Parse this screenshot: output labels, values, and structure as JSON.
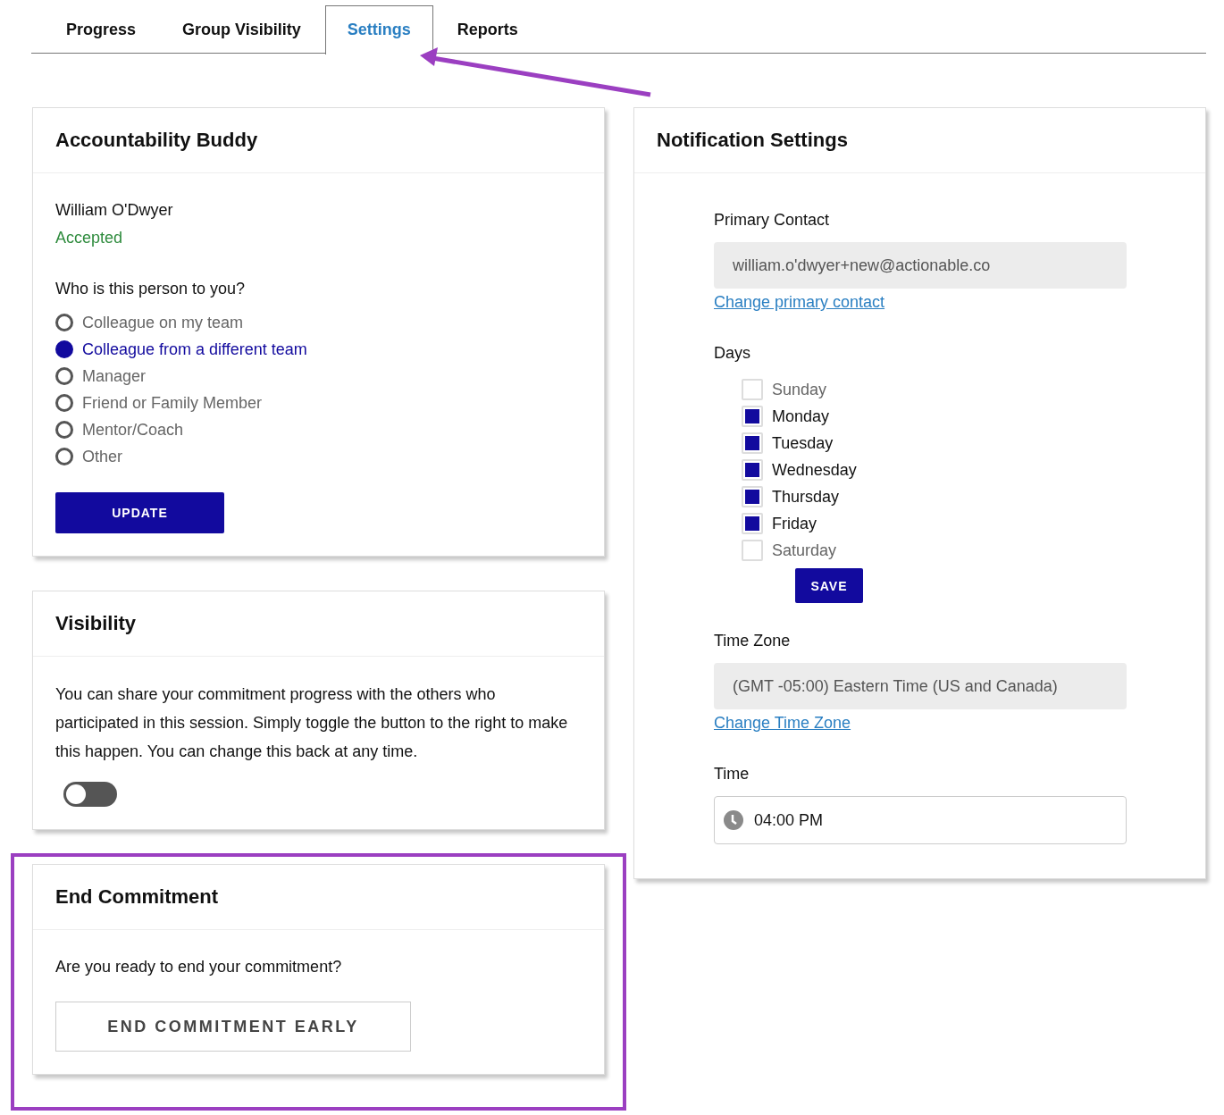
{
  "tabs": [
    {
      "label": "Progress",
      "selected": false
    },
    {
      "label": "Group Visibility",
      "selected": false
    },
    {
      "label": "Settings",
      "selected": true
    },
    {
      "label": "Reports",
      "selected": false
    }
  ],
  "buddy": {
    "title": "Accountability Buddy",
    "name": "William O'Dwyer",
    "status": "Accepted",
    "question": "Who is this person to you?",
    "options": [
      {
        "label": "Colleague on my team",
        "selected": false
      },
      {
        "label": "Colleague from a different team",
        "selected": true
      },
      {
        "label": "Manager",
        "selected": false
      },
      {
        "label": "Friend or Family Member",
        "selected": false
      },
      {
        "label": "Mentor/Coach",
        "selected": false
      },
      {
        "label": "Other",
        "selected": false
      }
    ],
    "button": "UPDATE"
  },
  "visibility": {
    "title": "Visibility",
    "text": "You can share your commitment progress with the others who participated in this session. Simply toggle the button to the right to make this happen. You can change this back at any time.",
    "toggle": {
      "on": false
    }
  },
  "end_commitment": {
    "title": "End Commitment",
    "question": "Are you ready to end your commitment?",
    "button": "END COMMITMENT EARLY"
  },
  "notifications": {
    "title": "Notification Settings",
    "primary_contact": {
      "label": "Primary Contact",
      "value": "william.o'dwyer+new@actionable.co",
      "link": "Change primary contact"
    },
    "days": {
      "label": "Days",
      "items": [
        {
          "label": "Sunday",
          "checked": false
        },
        {
          "label": "Monday",
          "checked": true
        },
        {
          "label": "Tuesday",
          "checked": true
        },
        {
          "label": "Wednesday",
          "checked": true
        },
        {
          "label": "Thursday",
          "checked": true
        },
        {
          "label": "Friday",
          "checked": true
        },
        {
          "label": "Saturday",
          "checked": false
        }
      ],
      "button": "SAVE"
    },
    "time_zone": {
      "label": "Time Zone",
      "value": "(GMT -05:00) Eastern Time (US and Canada)",
      "link": "Change Time Zone"
    },
    "time": {
      "label": "Time",
      "value": "04:00 PM"
    }
  }
}
